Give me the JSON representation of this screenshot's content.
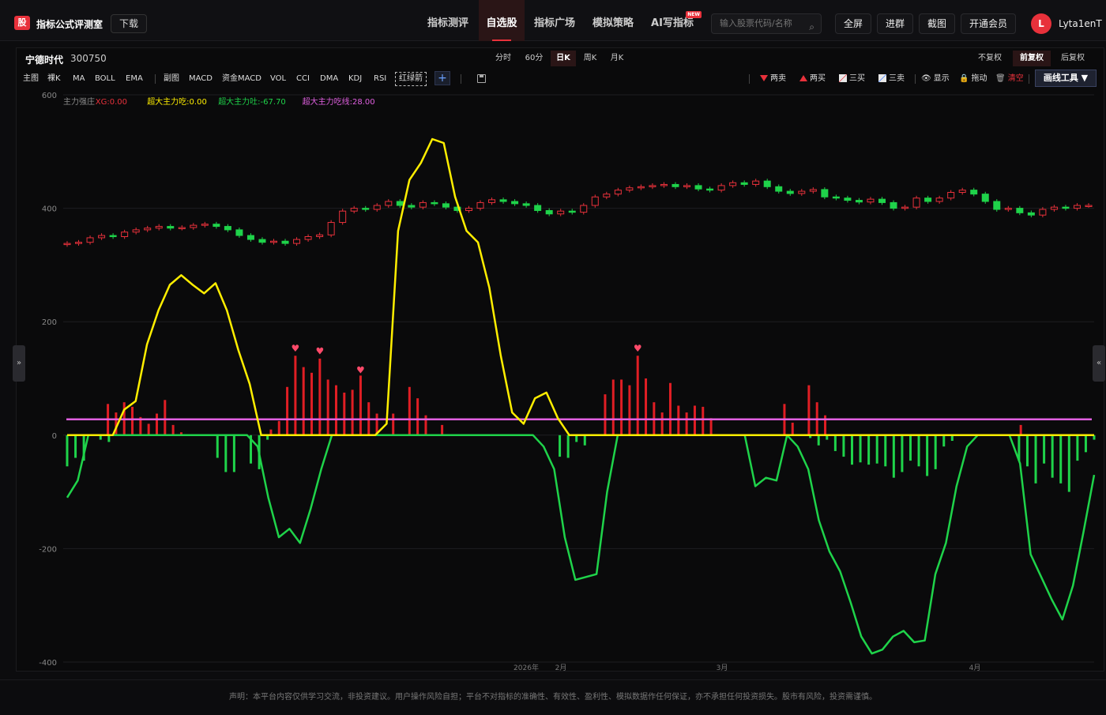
{
  "app": {
    "logo_char": "股",
    "title": "指标公式评测室",
    "download_label": "下载"
  },
  "nav": [
    {
      "label": "指标测评",
      "active": false
    },
    {
      "label": "自选股",
      "active": true
    },
    {
      "label": "指标广场",
      "active": false
    },
    {
      "label": "模拟策略",
      "active": false
    },
    {
      "label": "AI写指标",
      "active": false,
      "badge": "NEW"
    }
  ],
  "search": {
    "placeholder": "输入股票代码/名称",
    "icon": "search-icon"
  },
  "top_buttons": [
    "全屏",
    "进群",
    "截图",
    "开通会员"
  ],
  "user": {
    "avatar_letter": "L",
    "name": "Lyta1enT"
  },
  "stock": {
    "name": "宁德时代",
    "code": "300750"
  },
  "periods": [
    {
      "label": "分时",
      "active": false
    },
    {
      "label": "60分",
      "active": false
    },
    {
      "label": "日K",
      "active": true
    },
    {
      "label": "周K",
      "active": false
    },
    {
      "label": "月K",
      "active": false
    }
  ],
  "adjust": [
    {
      "label": "不复权",
      "active": false
    },
    {
      "label": "前复权",
      "active": true
    },
    {
      "label": "后复权",
      "active": false
    }
  ],
  "toolbar_left": {
    "main": [
      "主图",
      "裸K",
      "MA",
      "BOLL",
      "EMA"
    ],
    "sub": [
      "副图",
      "MACD",
      "资金MACD",
      "VOL",
      "CCI",
      "DMA",
      "KDJ",
      "RSI"
    ],
    "boxed": "红绿箭",
    "plus": "+"
  },
  "toolbar_right": {
    "items": [
      {
        "label": "两卖",
        "icon": "sell-triangle-icon"
      },
      {
        "label": "两买",
        "icon": "buy-triangle-icon"
      },
      {
        "label": "三买",
        "icon": "three-buy-icon"
      },
      {
        "label": "三卖",
        "icon": "three-sell-icon"
      },
      {
        "label": "显示",
        "icon": "eye-icon"
      },
      {
        "label": "拖动",
        "icon": "lock-icon"
      },
      {
        "label": "清空",
        "icon": "trash-icon",
        "color": "#e8313b"
      }
    ],
    "draw_tools": "画线工具 ▼"
  },
  "side": {
    "left": "»",
    "right": "«"
  },
  "chart_data": {
    "type": "line",
    "legend": [
      {
        "label": "主力强庄",
        "color": "#8a8a8a"
      },
      {
        "label": "XG:0.00",
        "color": "#e8313b"
      },
      {
        "label": "超大主力吃:0.00",
        "color": "#ffee00"
      },
      {
        "label": "超大主力吐:-67.70",
        "color": "#1fd34a"
      },
      {
        "label": "超大主力吃线:28.00",
        "color": "#e060e0"
      }
    ],
    "ylim": [
      -400,
      600
    ],
    "yticks": [
      600,
      400,
      200,
      0,
      -200,
      -400
    ],
    "xticks": [
      "2026年",
      "2月",
      "3月",
      "4月"
    ],
    "n_points": 90,
    "reference_line": {
      "value": 28,
      "color": "#e060e0"
    },
    "yellow_line": [
      0,
      0,
      0,
      0,
      0,
      45,
      60,
      160,
      220,
      265,
      282,
      265,
      250,
      268,
      220,
      150,
      90,
      0,
      0,
      0,
      0,
      0,
      0,
      0,
      0,
      0,
      0,
      0,
      20,
      360,
      450,
      480,
      522,
      515,
      420,
      360,
      340,
      260,
      140,
      40,
      20,
      65,
      75,
      30,
      0,
      0,
      0,
      0,
      0,
      0,
      0,
      0,
      0,
      0,
      0,
      0,
      0,
      0,
      0,
      0,
      0,
      0,
      0,
      0,
      0,
      0,
      0,
      0,
      0,
      0,
      0,
      0,
      0,
      0,
      0,
      0,
      0,
      0,
      0,
      0,
      0,
      0,
      0,
      0,
      0,
      0,
      0,
      0,
      0,
      0,
      0
    ],
    "green_line": [
      -110,
      -80,
      0,
      0,
      0,
      0,
      0,
      0,
      0,
      0,
      0,
      0,
      0,
      0,
      0,
      0,
      0,
      0,
      -20,
      -110,
      -180,
      -165,
      -190,
      -130,
      -60,
      0,
      0,
      0,
      0,
      0,
      0,
      0,
      0,
      0,
      0,
      0,
      0,
      0,
      0,
      0,
      0,
      0,
      0,
      0,
      0,
      -20,
      -60,
      -180,
      -255,
      -250,
      -245,
      -100,
      0,
      0,
      0,
      0,
      0,
      0,
      0,
      0,
      0,
      0,
      0,
      0,
      0,
      -90,
      -75,
      -80,
      0,
      -20,
      -60,
      -150,
      -205,
      -240,
      -295,
      -355,
      -385,
      -378,
      -355,
      -345,
      -365,
      -362,
      -245,
      -190,
      -90,
      -20,
      0,
      0,
      0,
      0,
      -50,
      -210,
      -250,
      -290,
      -325,
      -265,
      -170,
      -70
    ],
    "red_bars": [
      0,
      0,
      0,
      0,
      0,
      55,
      40,
      58,
      50,
      32,
      20,
      38,
      62,
      18,
      5,
      0,
      0,
      0,
      0,
      0,
      0,
      0,
      0,
      0,
      0,
      10,
      25,
      85,
      140,
      120,
      110,
      135,
      98,
      88,
      75,
      80,
      105,
      58,
      38,
      0,
      38,
      0,
      85,
      65,
      35,
      0,
      18,
      0,
      0,
      0,
      0,
      0,
      0,
      0,
      0,
      0,
      0,
      0,
      0,
      0,
      0,
      0,
      0,
      0,
      0,
      0,
      72,
      98,
      98,
      88,
      140,
      100,
      58,
      40,
      92,
      52,
      40,
      52,
      50,
      30,
      0,
      0,
      0,
      0,
      0,
      0,
      0,
      0,
      55,
      22,
      0,
      88,
      58,
      35,
      0,
      0,
      0,
      0,
      0,
      0,
      0,
      0,
      0,
      0,
      0,
      0,
      0,
      0,
      0,
      0,
      0,
      0,
      0,
      0,
      0,
      0,
      0,
      18,
      0,
      0,
      0,
      0,
      0,
      0,
      0,
      0,
      0
    ],
    "green_bars": [
      -55,
      -40,
      -45,
      0,
      -8,
      -12,
      0,
      0,
      0,
      0,
      0,
      0,
      0,
      0,
      0,
      0,
      0,
      0,
      -40,
      -65,
      -65,
      0,
      -50,
      -60,
      -8,
      0,
      0,
      0,
      0,
      0,
      0,
      0,
      0,
      0,
      0,
      0,
      0,
      0,
      0,
      0,
      0,
      0,
      0,
      0,
      0,
      0,
      0,
      0,
      0,
      0,
      0,
      0,
      0,
      0,
      0,
      0,
      0,
      0,
      0,
      -38,
      -40,
      -12,
      -18,
      0,
      0,
      0,
      0,
      0,
      0,
      0,
      0,
      0,
      0,
      0,
      0,
      0,
      0,
      0,
      0,
      0,
      0,
      0,
      0,
      0,
      0,
      0,
      0,
      0,
      0,
      -5,
      -18,
      -8,
      -28,
      -38,
      -52,
      -48,
      -52,
      -50,
      -55,
      -75,
      -65,
      -45,
      -55,
      -72,
      -60,
      -20,
      -10,
      0,
      0,
      0,
      0,
      0,
      0,
      0,
      -45,
      -55,
      -85,
      -50,
      -75,
      -85,
      -100,
      -45,
      -30,
      -8
    ],
    "hearts": [
      {
        "bar": 28,
        "value": 150
      },
      {
        "bar": 31,
        "value": 145
      },
      {
        "bar": 36,
        "value": 112
      },
      {
        "bar": 70,
        "value": 150
      }
    ],
    "candles_close": [
      338,
      340,
      348,
      352,
      350,
      358,
      362,
      365,
      368,
      365,
      366,
      370,
      372,
      368,
      362,
      352,
      345,
      340,
      342,
      338,
      345,
      350,
      353,
      375,
      395,
      400,
      398,
      405,
      412,
      405,
      402,
      410,
      408,
      402,
      396,
      400,
      410,
      415,
      412,
      408,
      405,
      396,
      390,
      395,
      393,
      405,
      420,
      425,
      432,
      436,
      438,
      440,
      442,
      438,
      440,
      434,
      432,
      440,
      445,
      442,
      448,
      438,
      430,
      426,
      430,
      433,
      420,
      418,
      414,
      411,
      416,
      410,
      400,
      402,
      418,
      412,
      418,
      428,
      432,
      425,
      412,
      398,
      400,
      392,
      388,
      398,
      402,
      400,
      405,
      405
    ]
  }
}
